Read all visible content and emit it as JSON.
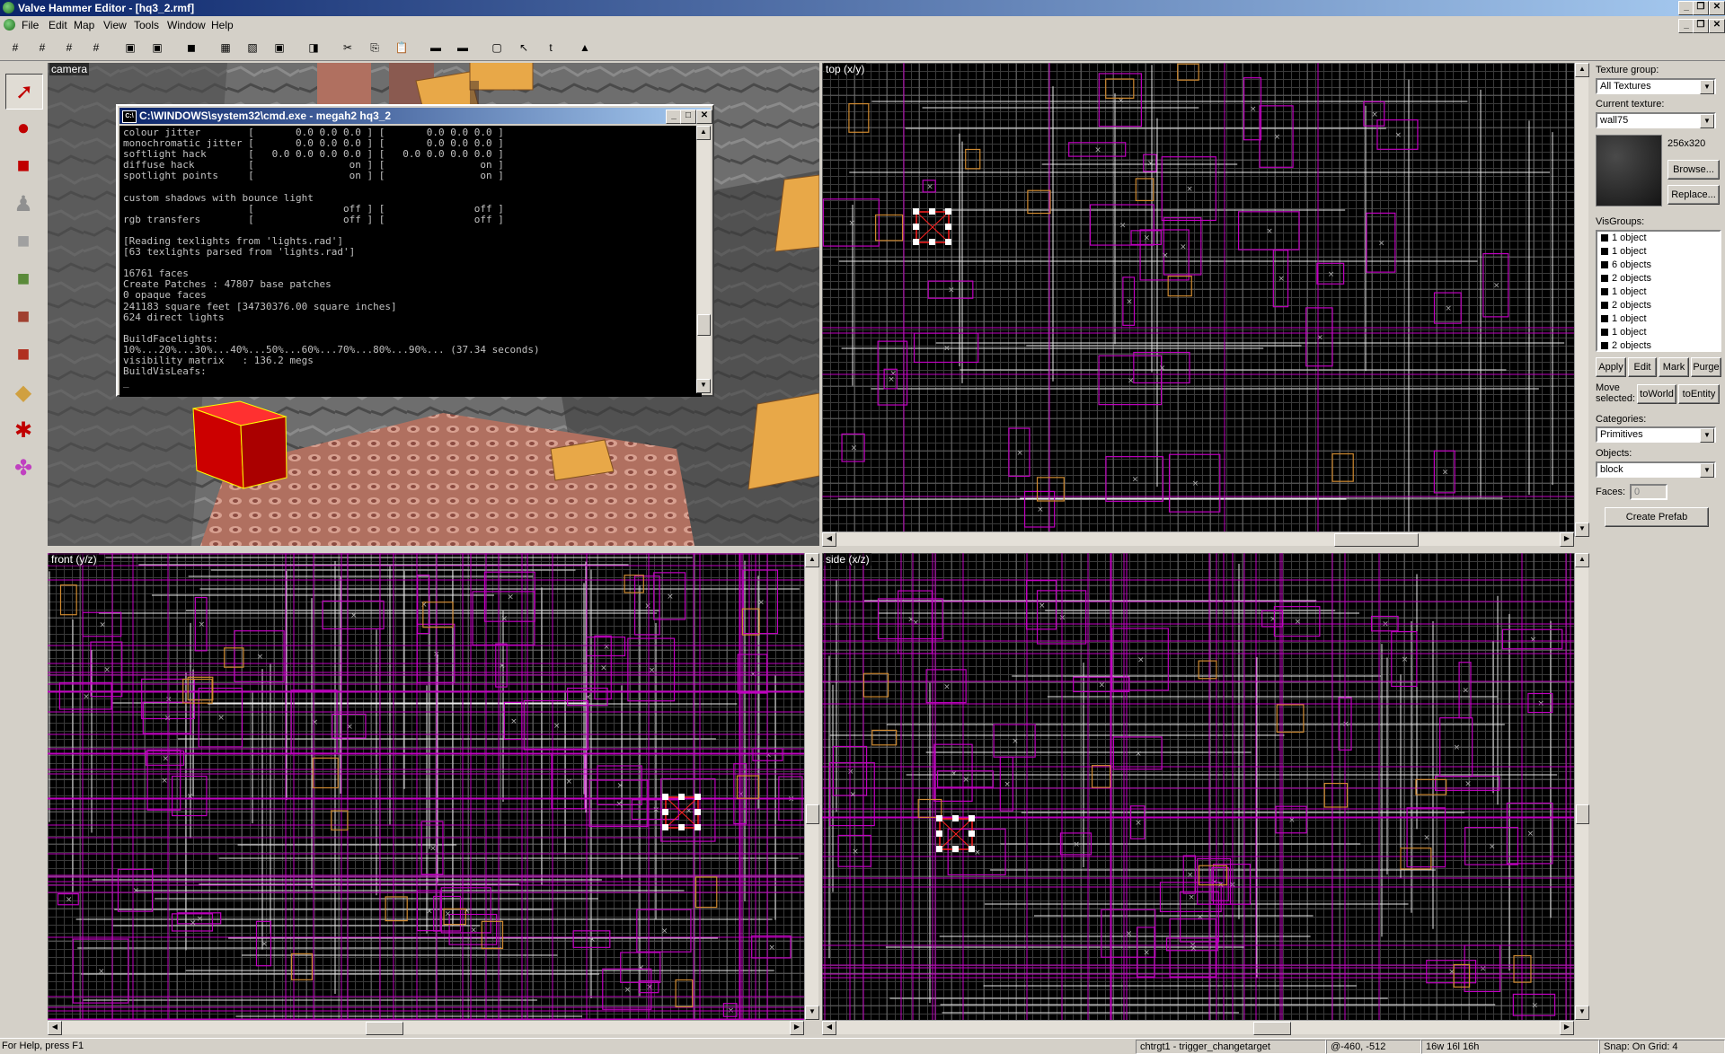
{
  "window": {
    "title": "Valve Hammer Editor - [hq3_2.rmf]",
    "buttons": [
      "_",
      "❐",
      "✕"
    ]
  },
  "menu": [
    "File",
    "Edit",
    "Map",
    "View",
    "Tools",
    "Window",
    "Help"
  ],
  "toolbar": {
    "icons": [
      "grid-icon",
      "grid-3d-icon",
      "grid-dense-icon",
      "grid-snap-icon",
      "group-icon",
      "ungroup-icon",
      "carve-icon",
      "hollow-icon",
      "texture-lock-icon",
      "undo-icon",
      "redo-icon",
      "cut-icon",
      "copy-icon",
      "paste-icon",
      "hide-icon",
      "show-icon",
      "cordon-icon",
      "select-icon",
      "toggle-texture-icon",
      "run-map-icon"
    ]
  },
  "palette": {
    "tools": [
      {
        "name": "selection-tool",
        "glyph": "➚",
        "color": "#c00000"
      },
      {
        "name": "magnify-tool",
        "glyph": "●",
        "color": "#c00000"
      },
      {
        "name": "camera-tool",
        "glyph": "■",
        "color": "#c00000"
      },
      {
        "name": "entity-tool",
        "glyph": "♟",
        "color": "#909090"
      },
      {
        "name": "block-tool",
        "glyph": "■",
        "color": "#a0a0a0"
      },
      {
        "name": "texture-tool",
        "glyph": "■",
        "color": "#5a8a3a"
      },
      {
        "name": "apply-texture-tool",
        "glyph": "■",
        "color": "#a04030"
      },
      {
        "name": "decal-tool",
        "glyph": "■",
        "color": "#b03020"
      },
      {
        "name": "clip-tool",
        "glyph": "◆",
        "color": "#d0a040"
      },
      {
        "name": "vertex-tool",
        "glyph": "✱",
        "color": "#c00000"
      },
      {
        "name": "path-tool",
        "glyph": "✤",
        "color": "#c040c0"
      }
    ]
  },
  "viewports": {
    "camera": {
      "label": "camera"
    },
    "top": {
      "label": "top (x/y)"
    },
    "front": {
      "label": "front (y/z)"
    },
    "side": {
      "label": "side (x/z)"
    }
  },
  "cmd": {
    "title": "C:\\WINDOWS\\system32\\cmd.exe - megah2 hq3_2",
    "lines": [
      "colour jitter        [       0.0 0.0 0.0 ] [       0.0 0.0 0.0 ]",
      "monochromatic jitter [       0.0 0.0 0.0 ] [       0.0 0.0 0.0 ]",
      "softlight hack       [   0.0 0.0 0.0 0.0 ] [   0.0 0.0 0.0 0.0 ]",
      "diffuse hack         [                on ] [                on ]",
      "spotlight points     [                on ] [                on ]",
      "",
      "custom shadows with bounce light",
      "                     [               off ] [               off ]",
      "rgb transfers        [               off ] [               off ]",
      "",
      "[Reading texlights from 'lights.rad']",
      "[63 texlights parsed from 'lights.rad']",
      "",
      "16761 faces",
      "Create Patches : 47807 base patches",
      "0 opaque faces",
      "241183 square feet [34730376.00 square inches]",
      "624 direct lights",
      "",
      "BuildFacelights:",
      "10%...20%...30%...40%...50%...60%...70%...80%...90%... (37.34 seconds)",
      "visibility matrix   : 136.2 megs",
      "BuildVisLeafs:"
    ]
  },
  "panel": {
    "texture_group_label": "Texture group:",
    "texture_group_value": "All Textures",
    "current_texture_label": "Current texture:",
    "current_texture_value": "wall75",
    "texture_size": "256x320",
    "browse": "Browse...",
    "replace": "Replace...",
    "visgroups_label": "VisGroups:",
    "visgroups": [
      "1 object",
      "1 object",
      "6 objects",
      "2 objects",
      "1 object",
      "2 objects",
      "1 object",
      "1 object",
      "2 objects"
    ],
    "apply": "Apply",
    "edit": "Edit",
    "mark": "Mark",
    "purge": "Purge",
    "move_selected": "Move selected:",
    "to_world": "toWorld",
    "to_entity": "toEntity",
    "categories_label": "Categories:",
    "categories_value": "Primitives",
    "objects_label": "Objects:",
    "objects_value": "block",
    "faces_label": "Faces:",
    "faces_value": "0",
    "create_prefab": "Create Prefab"
  },
  "status": {
    "help": "For Help, press F1",
    "selection": "chtrgt1 - trigger_changetarget",
    "coords": "@-460, -512",
    "size": "16w 16l 16h",
    "snap": "Snap: On Grid: 4"
  },
  "colors": {
    "brush_lines": "#c000c0",
    "grid_major": "#8a8a8a",
    "grid_minor": "#3a3a3a",
    "title_start": "#0a246a",
    "title_end": "#a6caf0"
  }
}
